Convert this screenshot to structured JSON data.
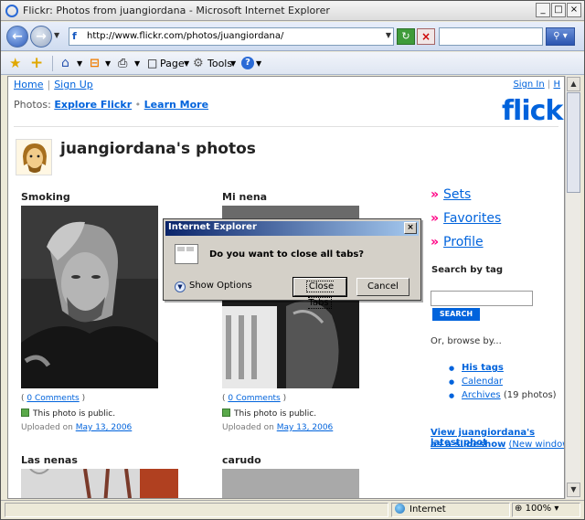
{
  "window": {
    "title": "Flickr: Photos from juangiordana - Microsoft Internet Explorer",
    "minimize": "_",
    "maximize": "□",
    "close": "×"
  },
  "address": {
    "url": "http://www.flickr.com/photos/juangiordana/",
    "favicon": "f",
    "search_placeholder": ""
  },
  "command_bar": {
    "page_label": "Page",
    "tools_label": "Tools"
  },
  "page": {
    "nav_home": "Home",
    "nav_signup": "Sign Up",
    "sign_in": "Sign In",
    "sign_in_sep": "H",
    "photos_label": "Photos:",
    "explore_flickr": "Explore Flickr",
    "learn_more": "Learn More",
    "logo_text": "flickr",
    "title": "juangiordana's photos"
  },
  "photos": [
    {
      "title": "Smoking",
      "comments": "0 Comments",
      "public": "This photo is public.",
      "uploaded_prefix": "Uploaded on",
      "uploaded_date": "May 13, 2006"
    },
    {
      "title": "Mi nena",
      "comments": "0 Comments",
      "public": "This photo is public.",
      "uploaded_prefix": "Uploaded on",
      "uploaded_date": "May 13, 2006"
    },
    {
      "title": "Las nenas"
    },
    {
      "title": "carudo"
    }
  ],
  "sidebar": {
    "links": [
      "Sets",
      "Favorites",
      "Profile"
    ],
    "search_by_tag": "Search by tag",
    "search_button": "SEARCH",
    "browse_by": "Or, browse by...",
    "his_tags": "His tags",
    "calendar": "Calendar",
    "archives": "Archives",
    "archives_count": "(19 photos)",
    "slideshow_line1": "View juangiordana's latest phot",
    "slideshow_line2": "as a slideshow",
    "new_window": "(New window"
  },
  "dialog": {
    "title": "Internet Explorer",
    "message": "Do you want to close all tabs?",
    "show_options": "Show Options",
    "close_tabs": "Close Tabs",
    "cancel": "Cancel"
  },
  "status": {
    "zone": "Internet",
    "zoom": "100%"
  }
}
